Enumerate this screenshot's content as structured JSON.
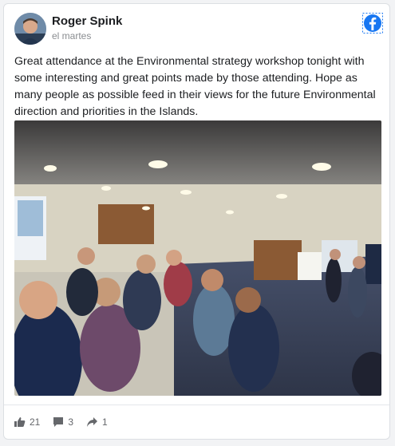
{
  "post": {
    "author": "Roger Spink",
    "timestamp": "el martes",
    "text": "Great attendance at the Environmental strategy workshop tonight with some interesting and great points made by those attending. Hope as many people as possible feed in their views for the future Environmental direction and priorities in the Islands."
  },
  "icons": {
    "network": "facebook-icon",
    "like": "thumbs-up-icon",
    "comment": "comment-icon",
    "share": "share-icon"
  },
  "reactions": {
    "likes": "21",
    "comments": "3",
    "shares": "1"
  },
  "colors": {
    "facebook": "#1877f2",
    "text": "#1c1e21",
    "muted": "#65676b"
  }
}
